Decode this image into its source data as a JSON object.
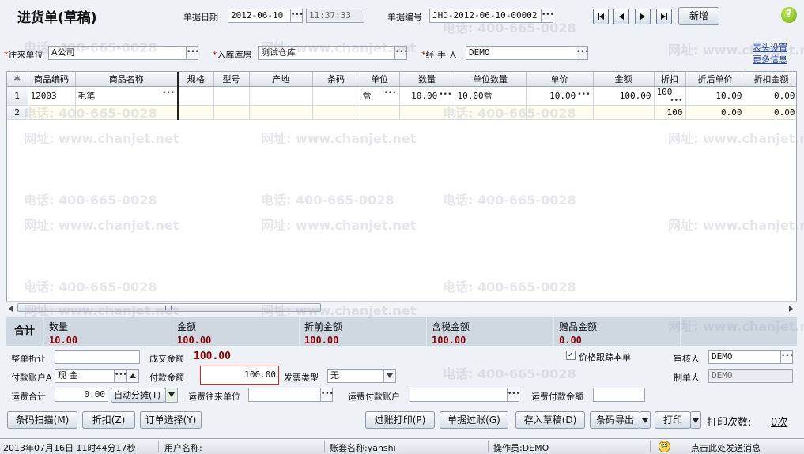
{
  "title": "进货单(草稿)",
  "header": {
    "date_label": "单据日期",
    "date_value": "2012-06-10",
    "time_value": "11:37:33",
    "doc_no_label": "单据编号",
    "doc_no_value": "JHD-2012-06-10-00002",
    "new_button": "新增",
    "supplier_label": "往来单位",
    "supplier_value": "A公司",
    "warehouse_label": "入库库房",
    "warehouse_value": "测试仓库",
    "handler_label": "经 手 人",
    "handler_value": "DEMO",
    "link_header_settings": "表头设置",
    "link_more_info": "更多信息",
    "required_mark": "*"
  },
  "grid": {
    "corner": "✱",
    "columns": [
      "商品编码",
      "商品名称",
      "规格",
      "型号",
      "产地",
      "条码",
      "单位",
      "数量",
      "单位数量",
      "单价",
      "金额",
      "折扣",
      "折后单价",
      "折扣金额"
    ],
    "rows": [
      {
        "idx": "1",
        "code": "12003",
        "name": "毛笔",
        "spec": "",
        "model": "",
        "origin": "",
        "barcode": "",
        "unit": "盒",
        "qty": "10.00",
        "unit_qty": "10.00盒",
        "price": "10.00",
        "amount": "100.00",
        "discount": "100",
        "disc_price": "10.00",
        "disc_amount": "0.00"
      },
      {
        "idx": "2",
        "code": "",
        "name": "",
        "spec": "",
        "model": "",
        "origin": "",
        "barcode": "",
        "unit": "",
        "qty": "",
        "unit_qty": "",
        "price": "",
        "amount": "",
        "discount": "100",
        "disc_price": "0.00",
        "disc_amount": "0.00"
      }
    ]
  },
  "summary": {
    "total_label": "合计",
    "qty_label": "数量",
    "qty_value": "10.00",
    "amount_label": "金额",
    "amount_value": "100.00",
    "pre_disc_label": "折前金额",
    "pre_disc_value": "100.00",
    "tax_label": "含税金额",
    "tax_value": "100.00",
    "gift_label": "赠品金额",
    "gift_value": "0.00"
  },
  "footer": {
    "whole_discount_label": "整单折让",
    "deal_amount_label": "成交金额",
    "deal_amount_value": "100.00",
    "price_track_label": "价格跟踪本单",
    "auditor_label": "审核人",
    "auditor_value": "DEMO",
    "pay_account_label": "付款账户A",
    "pay_account_value": "现   金",
    "pay_amount_label": "付款金额",
    "pay_amount_value": "100.00",
    "invoice_type_label": "发票类型",
    "invoice_type_value": "无",
    "maker_label": "制单人",
    "maker_value": "DEMO",
    "freight_total_label": "运费合计",
    "freight_total_value": "0.00",
    "auto_split_label": "自动分摊(T)",
    "freight_unit_label": "运费往来单位",
    "freight_account_label": "运费付款账户",
    "freight_pay_label": "运费付款金额"
  },
  "buttons": {
    "barcode_scan": "条码扫描(M)",
    "discount": "折扣(Z)",
    "order_select": "订单选择(Y)",
    "post_print": "过账打印(P)",
    "post": "单据过账(G)",
    "save_draft": "存入草稿(D)",
    "barcode_export": "条码导出",
    "print": "打印",
    "print_count_label": "打印次数:",
    "print_count_value": "0次"
  },
  "statusbar": {
    "datetime": "2013年07月16日  11时44分17秒",
    "user_label": "用户名称:",
    "account_label": "账套名称:yanshi",
    "operator_label": "操作员:DEMO",
    "message": "点击此处发送消息"
  },
  "watermark": {
    "phone": "电话: 400-665-0028",
    "site": "网址: www.chanjet.net"
  },
  "colors": {
    "total_value": "#8b0000",
    "help_icon": "#7ab800"
  }
}
